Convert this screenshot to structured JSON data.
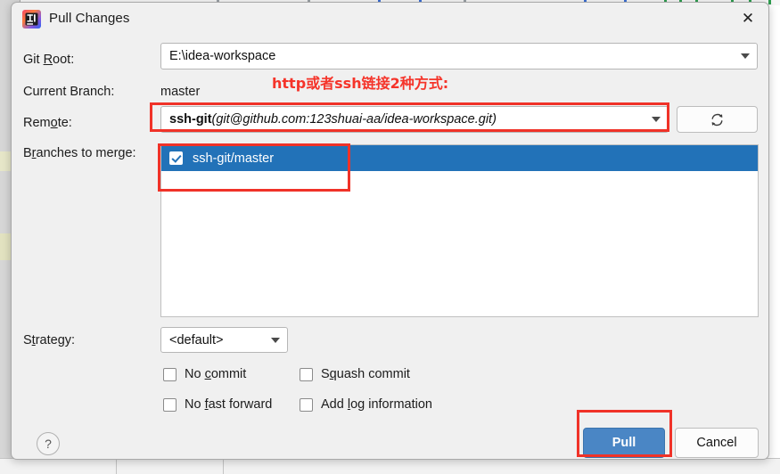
{
  "window": {
    "title": "Pull Changes",
    "app_icon": "intellij-idea-icon",
    "close_icon": "close-icon"
  },
  "form": {
    "git_root": {
      "label_before": "Git ",
      "label_mnemonic": "R",
      "label_after": "oot:",
      "value": "E:\\idea-workspace"
    },
    "current_branch": {
      "label": "Current Branch:",
      "value": "master"
    },
    "remote": {
      "label_before": "Rem",
      "label_mnemonic": "o",
      "label_after": "te:",
      "name": "ssh-git",
      "url": "(git@github.com:123shuai-aa/idea-workspace.git)",
      "refresh_icon": "refresh-icon"
    },
    "branches_to_merge": {
      "label_before": "B",
      "label_mnemonic": "r",
      "label_after": "anches to merge:",
      "items": [
        {
          "label": "ssh-git/master",
          "checked": true,
          "selected": true
        }
      ]
    },
    "strategy": {
      "label_before": "S",
      "label_mnemonic": "t",
      "label_after": "rategy:",
      "value": "<default>"
    },
    "options": [
      {
        "before": "No ",
        "mn": "c",
        "after": "ommit",
        "checked": false
      },
      {
        "before": "S",
        "mn": "q",
        "after": "uash commit",
        "checked": false
      },
      {
        "before": "No ",
        "mn": "f",
        "after": "ast forward",
        "checked": false
      },
      {
        "before": "Add ",
        "mn": "l",
        "after": "og information",
        "checked": false
      }
    ]
  },
  "footer": {
    "help_label": "?",
    "pull_label": "Pull",
    "cancel_label": "Cancel"
  },
  "annotations": {
    "note_text": "http或者ssh链接2种方式:",
    "color": "#f5342a"
  }
}
